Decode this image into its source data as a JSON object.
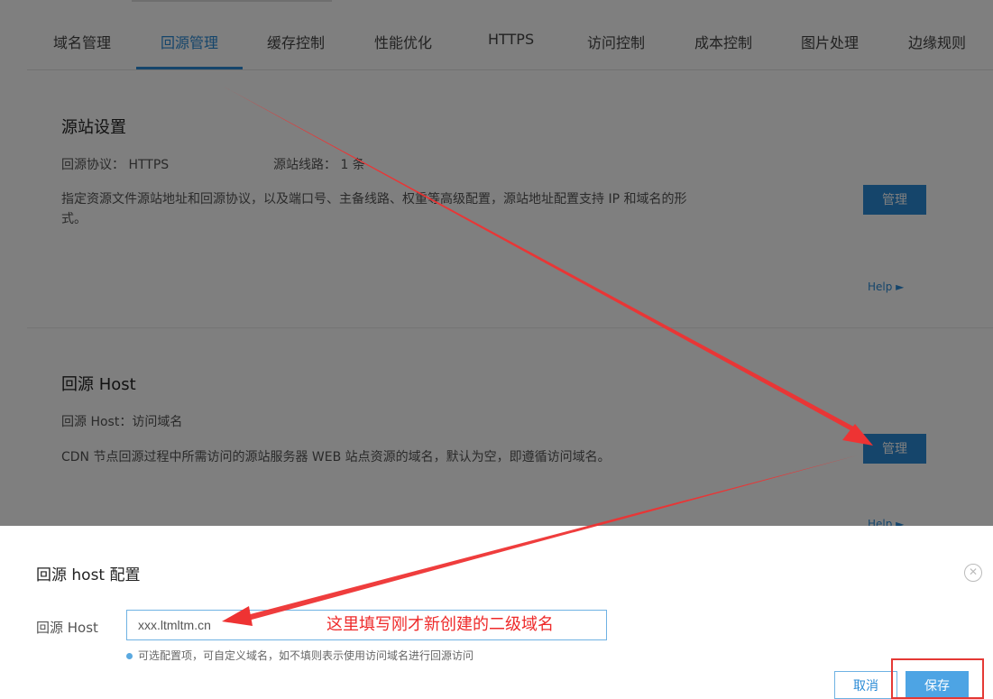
{
  "tabs": [
    {
      "label": "域名管理"
    },
    {
      "label": "回源管理"
    },
    {
      "label": "缓存控制"
    },
    {
      "label": "性能优化"
    },
    {
      "label": "HTTPS"
    },
    {
      "label": "访问控制"
    },
    {
      "label": "成本控制"
    },
    {
      "label": "图片处理"
    },
    {
      "label": "边缘规则"
    }
  ],
  "active_tab": "回源管理",
  "origin": {
    "title": "源站设置",
    "protocol_label": "回源协议：",
    "protocol_value": "HTTPS",
    "lines_label": "源站线路：",
    "lines_value": "1 条",
    "desc": "指定资源文件源站地址和回源协议，以及端口号、主备线路、权重等高级配置，源站地址配置支持 IP 和域名的形式。",
    "manage_label": "管理",
    "help_label": "Help ►"
  },
  "host": {
    "title": "回源 Host",
    "value_line": "回源 Host：访问域名",
    "desc": "CDN 节点回源过程中所需访问的源站服务器 WEB 站点资源的域名，默认为空，即遵循访问域名。",
    "manage_label": "管理",
    "help_label": "Help ►"
  },
  "modal": {
    "title": "回源 host 配置",
    "close_icon": "close-circle-icon",
    "field_label": "回源 Host",
    "field_value": "xxx.ltmltm.cn",
    "hint": "可选配置项，可自定义域名，如不填则表示使用访问域名进行回源访问",
    "cancel_label": "取消",
    "save_label": "保存"
  },
  "annotation": {
    "text": "这里填写刚才新创建的二级域名"
  },
  "colors": {
    "accent": "#2a8bd6",
    "annotation_red": "#ee2a2a"
  }
}
